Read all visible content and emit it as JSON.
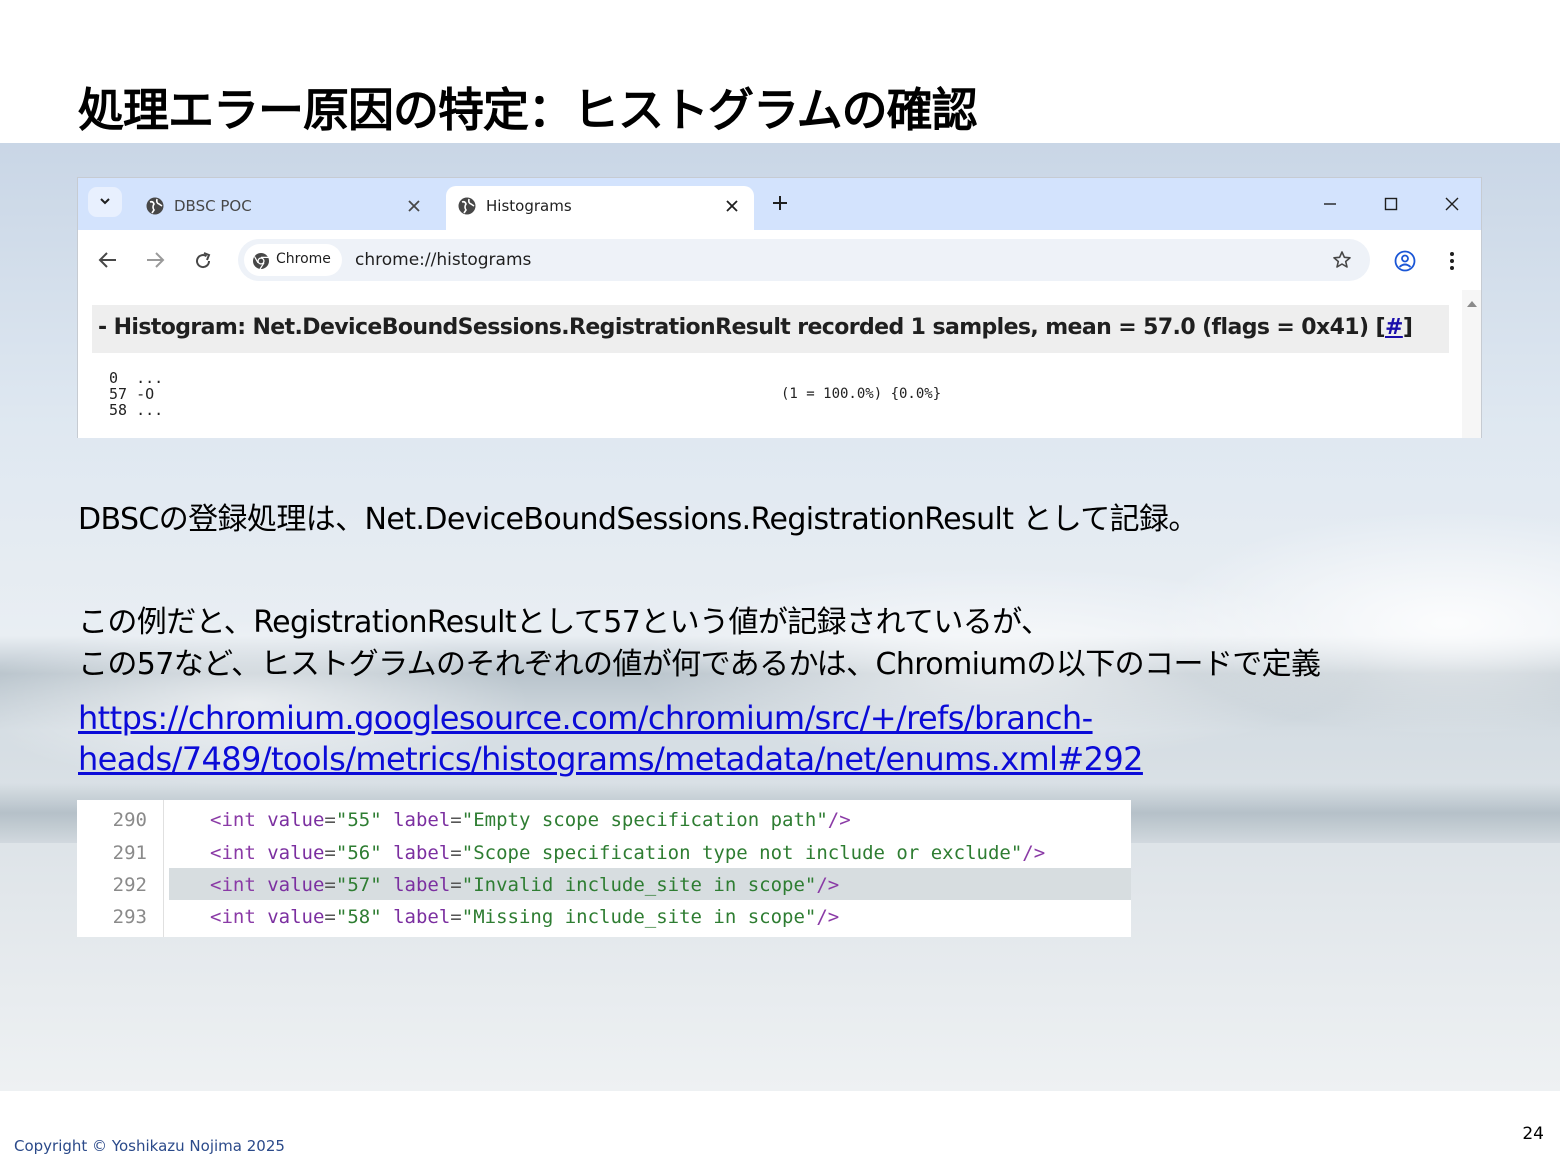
{
  "slide": {
    "title": "処理エラー原因の特定：ヒストグラムの確認",
    "paragraph1": "DBSCの登録処理は、Net.DeviceBoundSessions.RegistrationResult として記録。",
    "paragraph2_line1": "この例だと、RegistrationResultとして57という値が記録されているが、",
    "paragraph2_line2": "この57など、ヒストグラムのそれぞれの値が何であるかは、Chromiumの以下のコードで定義",
    "link_line1": "https://chromium.googlesource.com/chromium/src/+/refs/branch-",
    "link_line2": "heads/7489/tools/metrics/histograms/metadata/net/enums.xml#292",
    "copyright": "Copyright © Yoshikazu Nojima 2025",
    "page_number": "24"
  },
  "browser": {
    "tabs": [
      {
        "label": "DBSC POC",
        "active": false
      },
      {
        "label": "Histograms",
        "active": true
      }
    ],
    "chip_label": "Chrome",
    "url": "chrome://histograms",
    "histogram_header": "- Histogram: Net.DeviceBoundSessions.RegistrationResult recorded 1 samples, mean = 57.0 (flags = 0x41) [",
    "histogram_link": "#",
    "histogram_header_end": "]",
    "rows": [
      {
        "bucket": "0",
        "bar": "..."
      },
      {
        "bucket": "57",
        "bar": "-O"
      },
      {
        "bucket": "58",
        "bar": "..."
      }
    ],
    "row_stat": "(1 = 100.0%) {0.0%}"
  },
  "code": {
    "lines": [
      {
        "no": "290",
        "tag": "<int",
        "value_attr": "value",
        "value": "\"55\"",
        "label_attr": "label",
        "label": "\"Empty scope specification path\"",
        "close": "/>",
        "highlighted": false
      },
      {
        "no": "291",
        "tag": "<int",
        "value_attr": "value",
        "value": "\"56\"",
        "label_attr": "label",
        "label": "\"Scope specification type not include or exclude\"",
        "close": "/>",
        "highlighted": false
      },
      {
        "no": "292",
        "tag": "<int",
        "value_attr": "value",
        "value": "\"57\"",
        "label_attr": "label",
        "label": "\"Invalid include_site in scope\"",
        "close": "/>",
        "highlighted": true
      },
      {
        "no": "293",
        "tag": "<int",
        "value_attr": "value",
        "value": "\"58\"",
        "label_attr": "label",
        "label": "\"Missing include_site in scope\"",
        "close": "/>",
        "highlighted": false
      }
    ]
  },
  "colors": {
    "tabstrip": "#d3e3fd",
    "link": "#0b0bd8",
    "code_highlight": "#d7dde0",
    "code_string": "#2e7d32",
    "code_tag": "#8a3aa6"
  },
  "icons": [
    "chevron-down-icon",
    "globe-icon",
    "close-icon",
    "plus-icon",
    "minimize-icon",
    "maximize-icon",
    "back-icon",
    "forward-icon",
    "reload-icon",
    "chrome-logo-icon",
    "star-icon",
    "profile-icon",
    "kebab-menu-icon",
    "scroll-up-icon"
  ]
}
